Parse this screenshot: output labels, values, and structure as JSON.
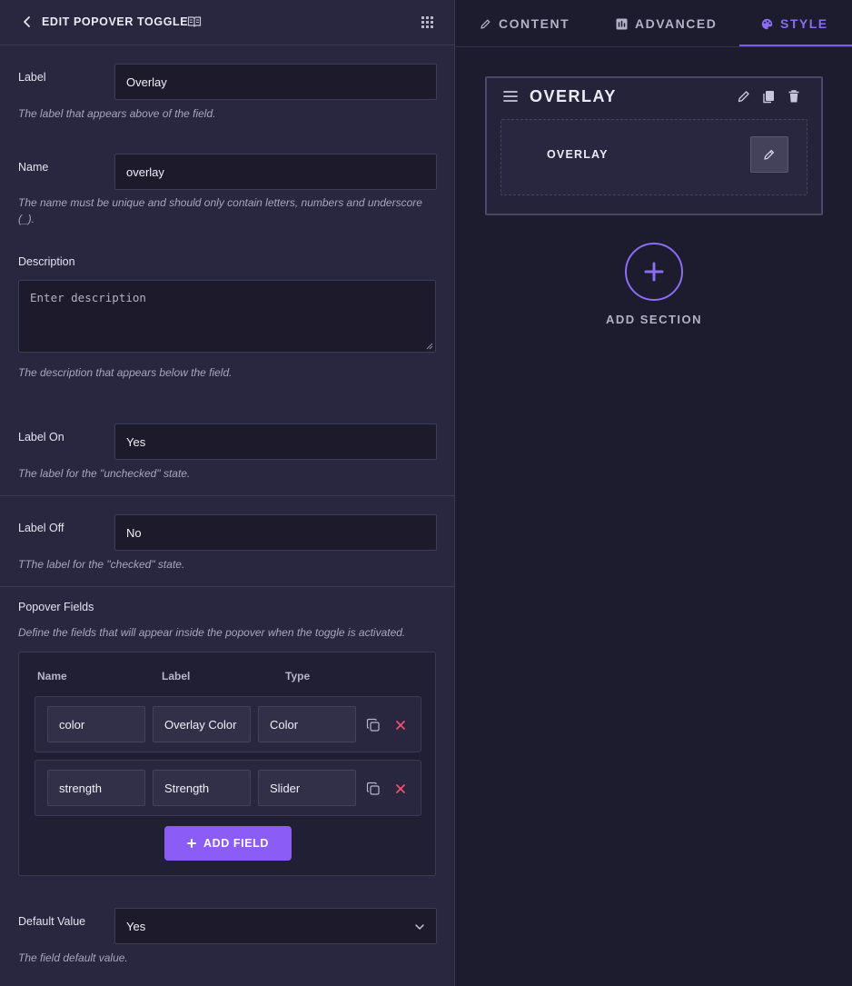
{
  "header": {
    "title": "EDIT POPOVER TOGGLE",
    "icons": {
      "back": "chevron-left-icon",
      "docs": "book-open-icon",
      "grid": "grid-dots-icon"
    }
  },
  "fields": {
    "label": {
      "label": "Label",
      "value": "Overlay",
      "help": "The label that appears above of the field."
    },
    "name": {
      "label": "Name",
      "value": "overlay",
      "help": "The name must be unique and should only contain letters, numbers and underscore (_)."
    },
    "description": {
      "label": "Description",
      "placeholder": "Enter description",
      "help": "The description that appears below the field."
    },
    "label_on": {
      "label": "Label On",
      "value": "Yes",
      "help": "The label for the \"unchecked\" state."
    },
    "label_off": {
      "label": "Label Off",
      "value": "No",
      "help": "TThe label for the \"checked\" state."
    },
    "popover_fields": {
      "label": "Popover Fields",
      "help": "Define the fields that will appear inside the popover when the toggle is activated.",
      "columns": [
        "Name",
        "Label",
        "Type"
      ],
      "rows": [
        {
          "name": "color",
          "label": "Overlay Color",
          "type": "Color"
        },
        {
          "name": "strength",
          "label": "Strength",
          "type": "Slider"
        }
      ],
      "add_label": "ADD FIELD"
    },
    "default_value": {
      "label": "Default Value",
      "value": "Yes",
      "help": "The field default value."
    }
  },
  "tabs": [
    {
      "label": "CONTENT",
      "icon": "pencil-icon",
      "active": false
    },
    {
      "label": "ADVANCED",
      "icon": "advanced-icon",
      "active": false
    },
    {
      "label": "STYLE",
      "icon": "palette-icon",
      "active": true
    }
  ],
  "section": {
    "title": "OVERLAY",
    "element_title": "OVERLAY",
    "add_section_label": "ADD SECTION"
  },
  "colors": {
    "accent": "#8b5cf6",
    "delete": "#f0506e",
    "panel": "#29263f",
    "background": "#1d1b2e"
  }
}
